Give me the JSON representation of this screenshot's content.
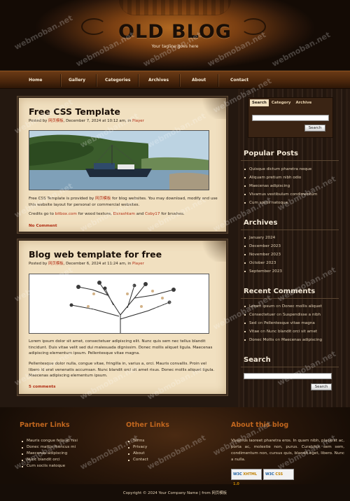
{
  "header": {
    "title": "OLD BLOG",
    "tagline": "Your tagline goes here"
  },
  "nav": {
    "items": [
      "Home",
      "Gallery",
      "Categories",
      "Archives",
      "About",
      "Contact"
    ]
  },
  "posts": [
    {
      "title": "Free CSS Template",
      "meta_prefix": "Posted by",
      "author": "网页模板",
      "meta_date": ", December 7, 2024 at 10:12 am, in",
      "category": "Player",
      "paragraph1_a": "Free CSS Template is provided by",
      "paragraph1_link": "网页模板",
      "paragraph1_b": "for blog websites. You may download, modify and use this website layout for personal or commercial websites.",
      "credits_a": "Credits go to",
      "credits_link1": "bitbox.com",
      "credits_b": "for wood texture,",
      "credits_link2": "Elcrashtam",
      "credits_c": "and",
      "credits_link3": "Coby17",
      "credits_d": "for brushes.",
      "comments": "No Comment"
    },
    {
      "title": "Blog web template for free",
      "meta_prefix": "Posted by",
      "author": "网页模板",
      "meta_date": ", December 6, 2024 at 11:24 am, in",
      "category": "Player",
      "paragraph1": "Lorem ipsum dolor sit amet, consectetuer adipiscing elit. Nunc quis sem nec tellus blandit tincidunt. Duis vitae velit sed dui malesuada dignissim. Donec mollis aliquet ligula. Maecenas adipiscing elementum ipsum. Pellentesque vitae magna.",
      "paragraph2": "Pellentesque dolor nulla, congue vitae, fringilla in, varius a, orci. Mauris convallis. Proin vel libero id erat venenatis accumsan. Nunc blandit orci sit amet risus. Donec mollis aliquet ligula. Maecenas adipiscing elementum ipsum.",
      "comments": "5 comments"
    }
  ],
  "search": {
    "tabs": [
      "Search",
      "Category",
      "Archive"
    ],
    "button": "Search"
  },
  "sidebar": {
    "popular_title": "Popular Posts",
    "popular": [
      "Quisque dictum pharetra neque",
      "Aliquam pretium nibh odio",
      "Maecenas adipiscing",
      "Vivamus vestibulum condimentum",
      "Cum sociis natoque"
    ],
    "archives_title": "Archives",
    "archives": [
      "January 2024",
      "December 2023",
      "November 2023",
      "October 2023",
      "September 2023"
    ],
    "comments_title": "Recent Comments",
    "comments": [
      {
        "name": "Lorem ipsum",
        "sep": " on ",
        "post": "Donec mollis aliquet"
      },
      {
        "name": "Consectetuer",
        "sep": " on ",
        "post": "Suspendisse a nibh"
      },
      {
        "name": "Sed",
        "sep": " on ",
        "post": "Pellentesque vitae magna"
      },
      {
        "name": "Vitae",
        "sep": " on ",
        "post": "Nunc blandit orci sit amet"
      },
      {
        "name": "Donec Mollis",
        "sep": " on ",
        "post": "Maecenas adipiscing"
      }
    ],
    "search_title": "Search",
    "search_button": "Search"
  },
  "footer": {
    "partner_title": "Partner Links",
    "partner": [
      "Mauris congue felis at nisi",
      "Donec mattis rhoncus mi",
      "Maecenas adipiscing",
      "Nunc blandit orci",
      "Cum sociis natoque"
    ],
    "other_title": "Other Links",
    "other": [
      "Terms",
      "Privacy",
      "About",
      "Contact"
    ],
    "about_title": "About this blog",
    "about_text": "Vivamus laoreet pharetra eros. In quam nibh, placerat ac, porta ac, molestie non, purus. Curabitur sem sem, condimentum non, cursus quis, blandit eget, libero. Nunc a nulla.",
    "badge1_a": "W3C",
    "badge1_b": "XHTML 1.0",
    "badge2_a": "W3C",
    "badge2_b": "CSS",
    "copyright": "Copyright © 2024 Your Company Name | from 网页模板"
  },
  "watermark": "webmoban.net",
  "colors": {
    "accent": "#b02a10",
    "footer_heading": "#c0661e",
    "paper": "#f1e0c0",
    "nav": "#4a260c"
  },
  "icons": [
    "boat-photo",
    "tree-photo"
  ]
}
